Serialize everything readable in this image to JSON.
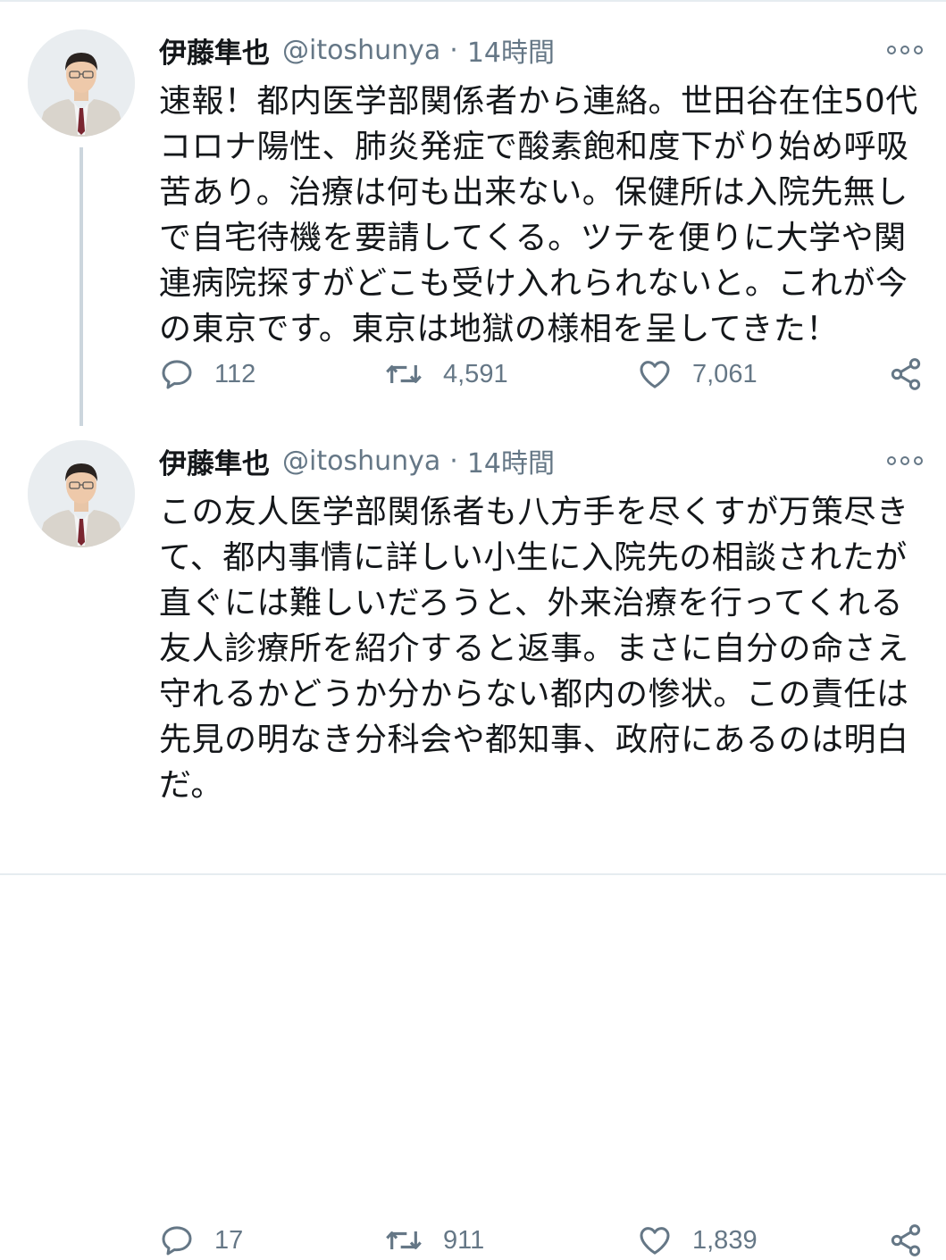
{
  "tweets": [
    {
      "display_name": "伊藤隼也",
      "handle": "@itoshunya",
      "separator": "·",
      "time": "14時間",
      "lines": [
        "速報！都内医学部関係者から連絡。世田谷在住50代",
        "コロナ陽性、肺炎発症で酸素飽和度下がり始め呼吸",
        "苦あり。治療は何も出来ない。保健所は入院先無し",
        "で自宅待機を要請してくる。ツテを便りに大学や関",
        "連病院探すがどこも受け入れられないと。これが今",
        "の東京です。東京は地獄の様相を呈してきた！"
      ],
      "replies": "112",
      "retweets": "4,591",
      "likes": "7,061"
    },
    {
      "display_name": "伊藤隼也",
      "handle": "@itoshunya",
      "separator": "·",
      "time": "14時間",
      "lines": [
        "この友人医学部関係者も八方手を尽くすが万策尽き",
        "て、都内事情に詳しい小生に入院先の相談されたが",
        "直ぐには難しいだろうと、外来治療を行ってくれる",
        "友人診療所を紹介すると返事。まさに自分の命さえ",
        "守れるかどうか分からない都内の惨状。この責任は",
        "先見の明なき分科会や都知事、政府にあるのは明白",
        "だ。"
      ],
      "replies": "17",
      "retweets": "911",
      "likes": "1,839"
    }
  ],
  "icons": {
    "avatar": "avatar-photo",
    "more": "more-icon",
    "reply": "reply-icon",
    "retweet": "retweet-icon",
    "like": "heart-icon",
    "share": "share-icon"
  },
  "colors": {
    "text": "#14171a",
    "secondary": "#657786",
    "border": "#e6ecf0",
    "thread_line": "#ccd6dd"
  }
}
